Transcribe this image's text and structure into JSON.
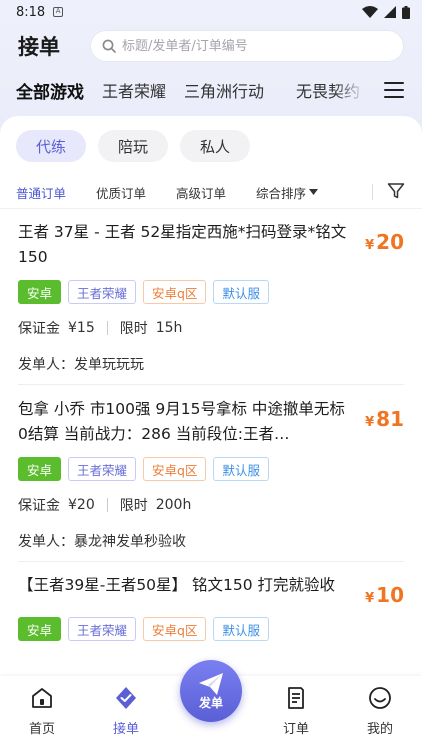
{
  "status_bar": {
    "time": "8:18",
    "notif_badge": "A"
  },
  "header": {
    "title": "接单",
    "search_placeholder": "标题/发单者/订单编号"
  },
  "game_tabs": [
    {
      "label": "全部游戏",
      "active": true
    },
    {
      "label": "王者荣耀",
      "active": false
    },
    {
      "label": "三角洲行动",
      "active": false
    },
    {
      "label": "无畏契约",
      "active": false
    }
  ],
  "order_types": [
    {
      "label": "代练",
      "active": true
    },
    {
      "label": "陪玩",
      "active": false
    },
    {
      "label": "私人",
      "active": false
    }
  ],
  "sort_options": [
    {
      "label": "普通订单",
      "active": true
    },
    {
      "label": "优质订单",
      "active": false
    },
    {
      "label": "高级订单",
      "active": false
    }
  ],
  "sort_dropdown": "综合排序",
  "orders": [
    {
      "title": "王者 37星 - 王者 52星指定西施*扫码登录*铭文150",
      "price_symbol": "¥",
      "price": "20",
      "tags": [
        "安卓",
        "王者荣耀",
        "安卓q区",
        "默认服"
      ],
      "deposit_label": "保证金",
      "deposit": "¥15",
      "time_label": "限时",
      "time": "15h",
      "sender_label": "发单人：",
      "sender": "发单玩玩玩"
    },
    {
      "title": "包拿 小乔 市100强 9月15号拿标 中途撤单无标0结算 当前战力：286 当前段位:王者…",
      "price_symbol": "¥",
      "price": "81",
      "tags": [
        "安卓",
        "王者荣耀",
        "安卓q区",
        "默认服"
      ],
      "deposit_label": "保证金",
      "deposit": "¥20",
      "time_label": "限时",
      "time": "200h",
      "sender_label": "发单人：",
      "sender": "暴龙神发单秒验收"
    },
    {
      "title": "【王者39星-王者50星】 铭文150 打完就验收",
      "price_symbol": "¥",
      "price": "10",
      "tags": [
        "安卓",
        "王者荣耀",
        "安卓q区",
        "默认服"
      ]
    }
  ],
  "bottom_nav": {
    "home": "首页",
    "orders_take": "接单",
    "publish": "发单",
    "my_orders": "订单",
    "mine": "我的"
  },
  "colors": {
    "accent": "#5a5fd6",
    "price": "#f07522",
    "tag_green": "#5bbd2e"
  }
}
